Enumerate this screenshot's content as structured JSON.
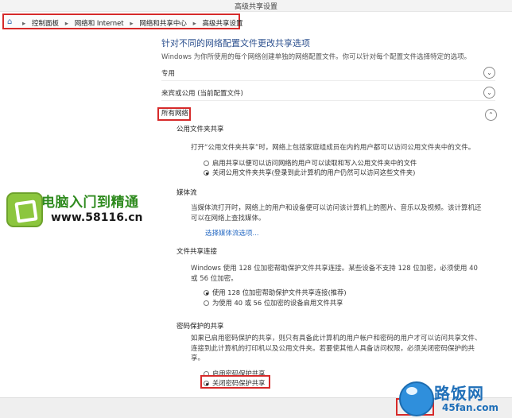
{
  "window": {
    "title": "高级共享设置"
  },
  "breadcrumb": {
    "items": [
      "控制面板",
      "网络和 Internet",
      "网络和共享中心",
      "高级共享设置"
    ],
    "separator": "▸"
  },
  "page": {
    "heading": "针对不同的网络配置文件更改共享选项",
    "description": "Windows 为你所使用的每个网络创建单独的网络配置文件。你可以针对每个配置文件选择特定的选项。"
  },
  "profiles": [
    {
      "label": "专用",
      "chevron": "⌄"
    },
    {
      "label": "来宾或公用 (当前配置文件)",
      "chevron": "⌄"
    },
    {
      "label": "所有网络",
      "chevron": "⌃"
    }
  ],
  "public_folder": {
    "title": "公用文件夹共享",
    "text": "打开“公用文件夹共享”时，网络上包括家庭组成员在内的用户都可以访问公用文件夹中的文件。",
    "options": [
      {
        "label": "启用共享以便可以访问网络的用户可以读取和写入公用文件夹中的文件",
        "selected": false
      },
      {
        "label": "关闭公用文件夹共享(登录到此计算机的用户仍然可以访问这些文件夹)",
        "selected": true
      }
    ]
  },
  "media": {
    "title": "媒体流",
    "text": "当媒体流打开时，网络上的用户和设备便可以访问该计算机上的图片、音乐以及视频。该计算机还可以在网络上查找媒体。",
    "link": "选择媒体流选项..."
  },
  "file_sharing": {
    "title": "文件共享连接",
    "text": "Windows 使用 128 位加密帮助保护文件共享连接。某些设备不支持 128 位加密，必须使用 40 或 56 位加密。",
    "options": [
      {
        "label": "使用 128 位加密帮助保护文件共享连接(推荐)",
        "selected": true
      },
      {
        "label": "为使用 40 或 56 位加密的设备启用文件共享",
        "selected": false
      }
    ]
  },
  "password": {
    "title": "密码保护的共享",
    "text": "如果已启用密码保护的共享，则只有具备此计算机的用户帐户和密码的用户才可以访问共享文件、连接到此计算机的打印机以及公用文件夹。若要使其他人具备访问权限，必须关闭密码保护的共享。",
    "options": [
      {
        "label": "启用密码保护共享",
        "selected": false
      },
      {
        "label": "关闭密码保护共享",
        "selected": true
      }
    ]
  },
  "watermarks": {
    "site1_name": "电脑入门到精通",
    "site1_url": "www.58116.cn",
    "site2_name": "路饭网",
    "site2_url": "45fan.com"
  },
  "colors": {
    "highlight": "#d62a2a",
    "link": "#2a6cc4",
    "heading": "#2b4f8e"
  }
}
